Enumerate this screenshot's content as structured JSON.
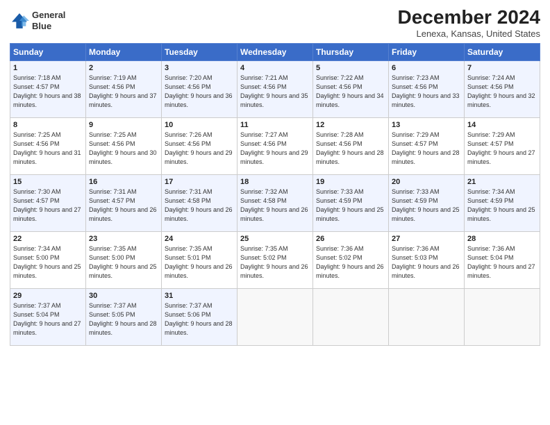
{
  "header": {
    "logo_line1": "General",
    "logo_line2": "Blue",
    "month": "December 2024",
    "location": "Lenexa, Kansas, United States"
  },
  "days_of_week": [
    "Sunday",
    "Monday",
    "Tuesday",
    "Wednesday",
    "Thursday",
    "Friday",
    "Saturday"
  ],
  "weeks": [
    [
      {
        "day": "1",
        "sunrise": "7:18 AM",
        "sunset": "4:57 PM",
        "daylight": "9 hours and 38 minutes."
      },
      {
        "day": "2",
        "sunrise": "7:19 AM",
        "sunset": "4:56 PM",
        "daylight": "9 hours and 37 minutes."
      },
      {
        "day": "3",
        "sunrise": "7:20 AM",
        "sunset": "4:56 PM",
        "daylight": "9 hours and 36 minutes."
      },
      {
        "day": "4",
        "sunrise": "7:21 AM",
        "sunset": "4:56 PM",
        "daylight": "9 hours and 35 minutes."
      },
      {
        "day": "5",
        "sunrise": "7:22 AM",
        "sunset": "4:56 PM",
        "daylight": "9 hours and 34 minutes."
      },
      {
        "day": "6",
        "sunrise": "7:23 AM",
        "sunset": "4:56 PM",
        "daylight": "9 hours and 33 minutes."
      },
      {
        "day": "7",
        "sunrise": "7:24 AM",
        "sunset": "4:56 PM",
        "daylight": "9 hours and 32 minutes."
      }
    ],
    [
      {
        "day": "8",
        "sunrise": "7:25 AM",
        "sunset": "4:56 PM",
        "daylight": "9 hours and 31 minutes."
      },
      {
        "day": "9",
        "sunrise": "7:25 AM",
        "sunset": "4:56 PM",
        "daylight": "9 hours and 30 minutes."
      },
      {
        "day": "10",
        "sunrise": "7:26 AM",
        "sunset": "4:56 PM",
        "daylight": "9 hours and 29 minutes."
      },
      {
        "day": "11",
        "sunrise": "7:27 AM",
        "sunset": "4:56 PM",
        "daylight": "9 hours and 29 minutes."
      },
      {
        "day": "12",
        "sunrise": "7:28 AM",
        "sunset": "4:56 PM",
        "daylight": "9 hours and 28 minutes."
      },
      {
        "day": "13",
        "sunrise": "7:29 AM",
        "sunset": "4:57 PM",
        "daylight": "9 hours and 28 minutes."
      },
      {
        "day": "14",
        "sunrise": "7:29 AM",
        "sunset": "4:57 PM",
        "daylight": "9 hours and 27 minutes."
      }
    ],
    [
      {
        "day": "15",
        "sunrise": "7:30 AM",
        "sunset": "4:57 PM",
        "daylight": "9 hours and 27 minutes."
      },
      {
        "day": "16",
        "sunrise": "7:31 AM",
        "sunset": "4:57 PM",
        "daylight": "9 hours and 26 minutes."
      },
      {
        "day": "17",
        "sunrise": "7:31 AM",
        "sunset": "4:58 PM",
        "daylight": "9 hours and 26 minutes."
      },
      {
        "day": "18",
        "sunrise": "7:32 AM",
        "sunset": "4:58 PM",
        "daylight": "9 hours and 26 minutes."
      },
      {
        "day": "19",
        "sunrise": "7:33 AM",
        "sunset": "4:59 PM",
        "daylight": "9 hours and 25 minutes."
      },
      {
        "day": "20",
        "sunrise": "7:33 AM",
        "sunset": "4:59 PM",
        "daylight": "9 hours and 25 minutes."
      },
      {
        "day": "21",
        "sunrise": "7:34 AM",
        "sunset": "4:59 PM",
        "daylight": "9 hours and 25 minutes."
      }
    ],
    [
      {
        "day": "22",
        "sunrise": "7:34 AM",
        "sunset": "5:00 PM",
        "daylight": "9 hours and 25 minutes."
      },
      {
        "day": "23",
        "sunrise": "7:35 AM",
        "sunset": "5:00 PM",
        "daylight": "9 hours and 25 minutes."
      },
      {
        "day": "24",
        "sunrise": "7:35 AM",
        "sunset": "5:01 PM",
        "daylight": "9 hours and 26 minutes."
      },
      {
        "day": "25",
        "sunrise": "7:35 AM",
        "sunset": "5:02 PM",
        "daylight": "9 hours and 26 minutes."
      },
      {
        "day": "26",
        "sunrise": "7:36 AM",
        "sunset": "5:02 PM",
        "daylight": "9 hours and 26 minutes."
      },
      {
        "day": "27",
        "sunrise": "7:36 AM",
        "sunset": "5:03 PM",
        "daylight": "9 hours and 26 minutes."
      },
      {
        "day": "28",
        "sunrise": "7:36 AM",
        "sunset": "5:04 PM",
        "daylight": "9 hours and 27 minutes."
      }
    ],
    [
      {
        "day": "29",
        "sunrise": "7:37 AM",
        "sunset": "5:04 PM",
        "daylight": "9 hours and 27 minutes."
      },
      {
        "day": "30",
        "sunrise": "7:37 AM",
        "sunset": "5:05 PM",
        "daylight": "9 hours and 28 minutes."
      },
      {
        "day": "31",
        "sunrise": "7:37 AM",
        "sunset": "5:06 PM",
        "daylight": "9 hours and 28 minutes."
      },
      null,
      null,
      null,
      null
    ]
  ]
}
